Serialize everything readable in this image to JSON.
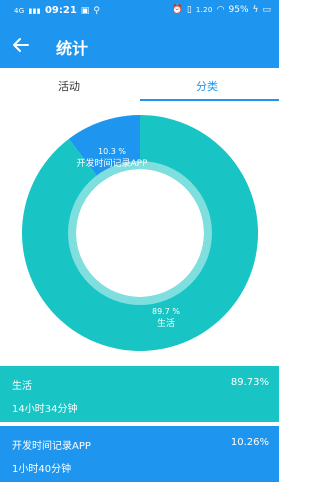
{
  "status": {
    "signal": "4G",
    "time": "09:21",
    "right_text": "95%",
    "speed": "1.20"
  },
  "toolbar": {
    "title": "统计"
  },
  "tabs": [
    {
      "label": "活动"
    },
    {
      "label": "分类"
    }
  ],
  "chart_data": {
    "type": "pie",
    "slices": [
      {
        "name": "生活",
        "value": 89.7,
        "label_pct": "89.7 %",
        "color": "#18c4c4"
      },
      {
        "name": "开发时间记录APP",
        "value": 10.3,
        "label_pct": "10.3 %",
        "color": "#1e96f0"
      }
    ]
  },
  "list": [
    {
      "name": "生活",
      "percent": "89.73%",
      "duration": "14小时34分钟",
      "color": "#18c4c4"
    },
    {
      "name": "开发时间记录APP",
      "percent": "10.26%",
      "duration": "1小时40分钟",
      "color": "#1e96f0"
    }
  ]
}
